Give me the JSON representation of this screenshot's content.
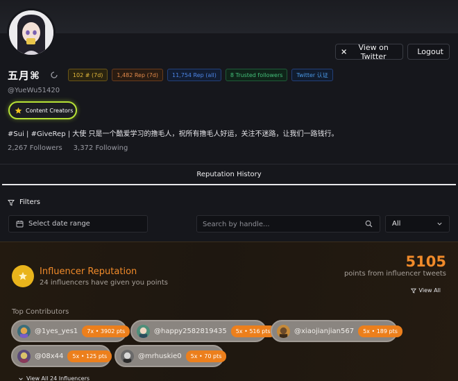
{
  "header": {
    "view_twitter_label": "View on Twitter",
    "logout_label": "Logout"
  },
  "profile": {
    "name": "五月⌘",
    "handle": "@YueWu51420",
    "badges": [
      "102 # (7d)",
      "1,482 Rep (7d)",
      "11,754 Rep (all)",
      "8 Trusted followers",
      "Twitter 认证"
    ],
    "creator_label": "Content Creators",
    "bio": "#Sui | #GiveRep | 大使 只是一个酷爱学习的撸毛人，祝所有撸毛人好运，关注不迷路，让我们一路钱行。",
    "followers": "2,267 Followers",
    "following": "3,372 Following"
  },
  "tabs": {
    "active": "Reputation History"
  },
  "filters": {
    "title": "Filters",
    "date_label": "Select date range",
    "search_placeholder": "Search by handle...",
    "select_value": "All"
  },
  "influencer": {
    "title": "Influencer Reputation",
    "subtitle": "24 influencers have given you points",
    "points": "5105",
    "points_label": "points from influencer tweets",
    "view_all": "View All",
    "top_contributors_label": "Top Contributors",
    "contributors": [
      {
        "handle": "@1yes_yes1",
        "pts": "7x • 3902 pts"
      },
      {
        "handle": "@happy2582819435",
        "pts": "5x • 516 pts"
      },
      {
        "handle": "@xiaojianjian567",
        "pts": "5x • 189 pts"
      },
      {
        "handle": "@08x44",
        "pts": "5x • 125 pts"
      },
      {
        "handle": "@mrhuskie0",
        "pts": "5x • 70 pts"
      }
    ],
    "view_all_influencers": "View All 24 Influencers"
  },
  "colors": {
    "accent_orange": "#f08a2a",
    "creator_border": "#b7e236",
    "background": "#16171c"
  },
  "icons": [
    "x-logo-icon",
    "logout-icon",
    "refresh-icon",
    "star-icon",
    "filter-icon",
    "calendar-icon",
    "search-icon",
    "chevron-down-icon"
  ]
}
